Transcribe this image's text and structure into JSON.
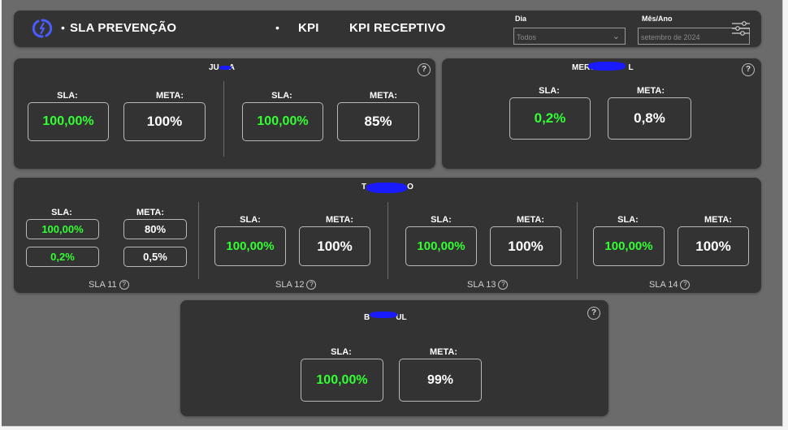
{
  "header": {
    "title": "SLA PREVENÇÃO",
    "nav_kpi": "KPI",
    "nav_kpi_receptivo": "KPI RECEPTIVO",
    "filters": {
      "dia_label": "Dia",
      "dia_value": "Todos",
      "mesano_label": "Mês/Ano",
      "mesano_value": "setembro de 2024"
    }
  },
  "cards": {
    "junta": {
      "title_left": "JU",
      "title_right": "A",
      "left": {
        "sla_label": "SLA:",
        "sla_value": "100,00%",
        "meta_label": "META:",
        "meta_value": "100%"
      },
      "right": {
        "sla_label": "SLA:",
        "sla_value": "100,00%",
        "meta_label": "META:",
        "meta_value": "85%"
      }
    },
    "merc": {
      "title_left": "MERC",
      "title_right": "L",
      "sla_label": "SLA:",
      "sla_value": "0,2%",
      "meta_label": "META:",
      "meta_value": "0,8%"
    },
    "t": {
      "title_left": "T",
      "title_right": "O",
      "sla11": {
        "sla_label": "SLA:",
        "meta_label": "META:",
        "sla_value_1": "100,00%",
        "meta_value_1": "80%",
        "sla_value_2": "0,2%",
        "meta_value_2": "0,5%",
        "footer": "SLA 11"
      },
      "sla12": {
        "sla_label": "SLA:",
        "sla_value": "100,00%",
        "meta_label": "META:",
        "meta_value": "100%",
        "footer": "SLA 12"
      },
      "sla13": {
        "sla_label": "SLA:",
        "sla_value": "100,00%",
        "meta_label": "META:",
        "meta_value": "100%",
        "footer": "SLA 13"
      },
      "sla14": {
        "sla_label": "SLA:",
        "sla_value": "100,00%",
        "meta_label": "META:",
        "meta_value": "100%",
        "footer": "SLA 14"
      }
    },
    "b": {
      "title_left": "B",
      "title_right": "UL",
      "sla_label": "SLA:",
      "sla_value": "100,00%",
      "meta_label": "META:",
      "meta_value": "99%"
    }
  },
  "help_glyph": "?",
  "colors": {
    "accent_green": "#33ff33",
    "panel": "#333333",
    "background": "#6b6b6b",
    "logo_blue": "#4a5cff",
    "redaction_blue": "#1a1aff"
  },
  "icons": {
    "logo": "brand-swirl-icon",
    "filter": "sliders-icon",
    "help": "help-circle-icon",
    "dropdown": "chevron-down-icon"
  }
}
